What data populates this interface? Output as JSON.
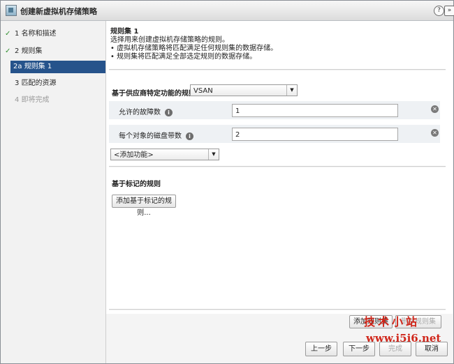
{
  "window": {
    "title": "创建新虚拟机存储策略",
    "help_label": "?",
    "expand_label": "»"
  },
  "steps": [
    {
      "mark": "✓",
      "number": "1",
      "label": "名称和描述",
      "state": "done"
    },
    {
      "mark": "✓",
      "number": "2",
      "label": "规则集",
      "state": "done"
    },
    {
      "mark": "",
      "number": "2a",
      "label": "规则集 1",
      "state": "active"
    },
    {
      "mark": "",
      "number": "3",
      "label": "匹配的资源",
      "state": "normal"
    },
    {
      "mark": "",
      "number": "4",
      "label": "即将完成",
      "state": "disabled"
    }
  ],
  "main": {
    "ruleset_title": "规则集 1",
    "desc_line1": "选择用来创建虚拟机存储策略的规则。",
    "desc_line2": "• 虚拟机存储策略将匹配满足任何规则集的数据存储。",
    "desc_line3": "• 规则集将匹配满足全部选定规则的数据存储。",
    "vendor_rules_label": "基于供应商特定功能的规则",
    "vendor_select_value": "VSAN",
    "capabilities": [
      {
        "label": "允许的故障数",
        "value": "1"
      },
      {
        "label": "每个对象的磁盘带数",
        "value": "2"
      }
    ],
    "add_capability_value": "<添加功能>",
    "tag_rules_label": "基于标记的规则",
    "add_tag_rule_button": "添加基于标记的规则..."
  },
  "ruleset_buttons": {
    "add_ruleset": "添加规则集",
    "remove_ruleset": "删除规则集"
  },
  "footer": {
    "back": "上一步",
    "next": "下一步",
    "finish": "完成",
    "cancel": "取消"
  },
  "watermark": {
    "text": "技术小站",
    "url": "www.i5i6.net",
    "color": "#d0261a"
  }
}
